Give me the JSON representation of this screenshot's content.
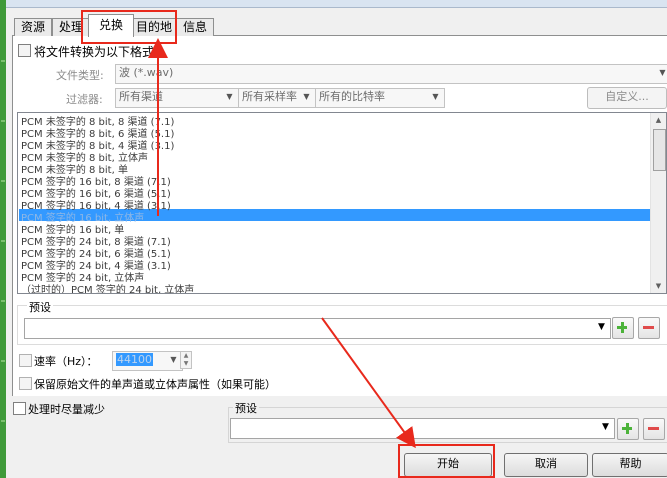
{
  "tabs": [
    "资源",
    "处理",
    "兑换",
    "目的地",
    "信息"
  ],
  "convert_checkbox_label": "将文件转换为以下格式:",
  "file_type": {
    "label": "文件类型:",
    "value": "波 (*.wav)"
  },
  "filter": {
    "label": "过滤器:",
    "channels": "所有渠道",
    "sample_rate": "所有采样率",
    "bit_rate": "所有的比特率",
    "customize_button": "自定义..."
  },
  "formats": [
    "PCM 未签字的 8 bit, 8 渠道 (7.1)",
    "PCM 未签字的 8 bit, 6 渠道 (5.1)",
    "PCM 未签字的 8 bit, 4 渠道 (3.1)",
    "PCM 未签字的 8 bit, 立体声",
    "PCM 未签字的 8 bit, 单",
    "PCM 签字的 16 bit, 8 渠道 (7.1)",
    "PCM 签字的 16 bit, 6 渠道 (5.1)",
    "PCM 签字的 16 bit, 4 渠道 (3.1)",
    "PCM 签字的 16 bit, 立体声",
    "PCM 签字的 16 bit, 单",
    "PCM 签字的 24 bit, 8 渠道 (7.1)",
    "PCM 签字的 24 bit, 6 渠道 (5.1)",
    "PCM 签字的 24 bit, 4 渠道 (3.1)",
    "PCM 签字的 24 bit, 立体声",
    "（过时的）PCM 签字的 24 bit, 立体声"
  ],
  "selected_format_index": 8,
  "preset_top": {
    "label": "预设",
    "value": ""
  },
  "sample_rate": {
    "label": "速率（Hz）：",
    "value": "44100"
  },
  "keep_channels_label": "保留原始文件的单声道或立体声属性（如果可能）",
  "minimize_label": "处理时尽量减少",
  "preset_bottom": {
    "label": "预设",
    "value": ""
  },
  "buttons": {
    "start": "开始",
    "cancel": "取消",
    "help": "帮助"
  },
  "accent_colors": {
    "selection": "#3399ff",
    "annotation": "#e8291c",
    "add": "#4cb33a",
    "remove": "#e04b4b"
  }
}
